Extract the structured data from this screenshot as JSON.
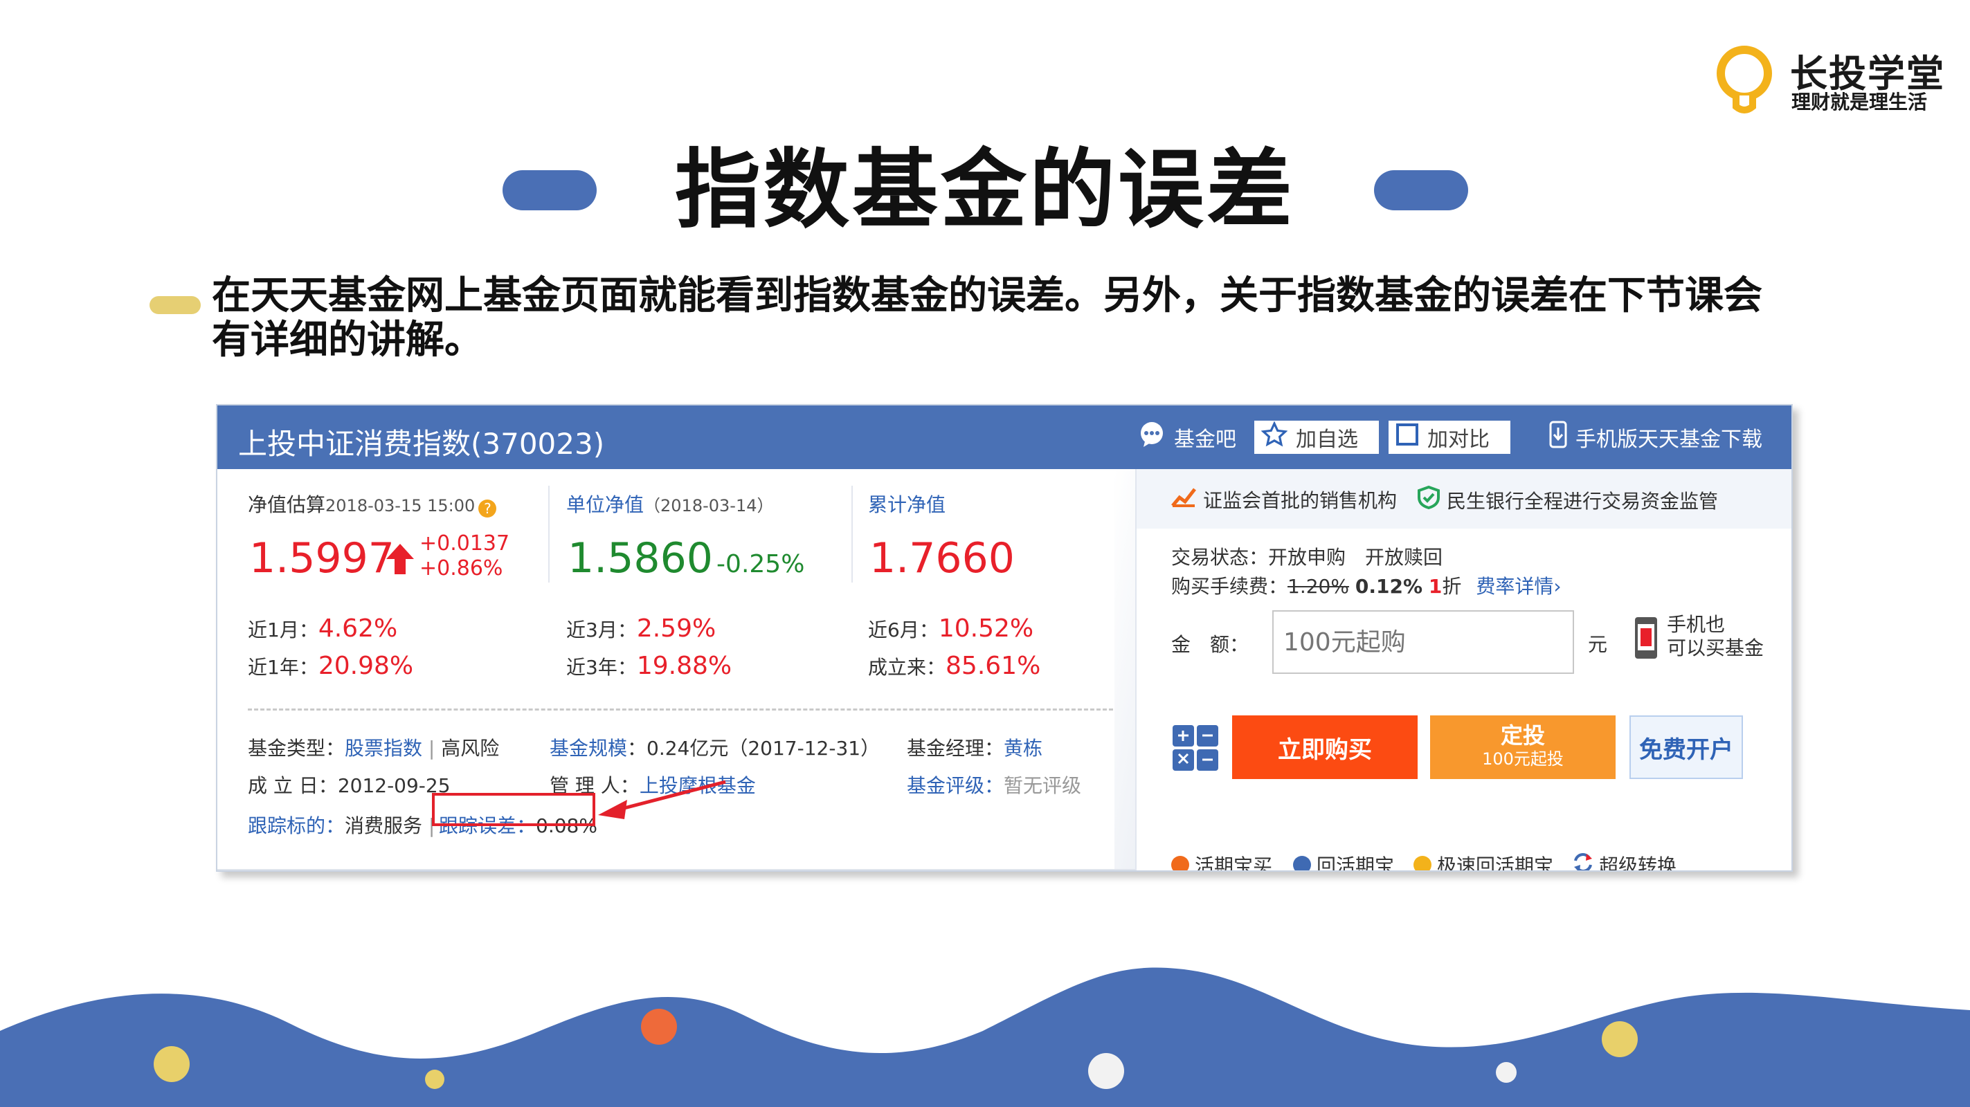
{
  "brand": {
    "name": "长投学堂",
    "slogan": "理财就是理生活"
  },
  "slide": {
    "title": "指数基金的误差",
    "intro": "在天天基金网上基金页面就能看到指数基金的误差。另外，关于指数基金的误差在下节课会有详细的讲解。"
  },
  "fund": {
    "title": "上投中证消费指数(370023)",
    "header_buttons": {
      "bar": "基金吧",
      "watch": "加自选",
      "compare": "加对比",
      "mobile": "手机版天天基金下载"
    },
    "estimate": {
      "label": "净值估算",
      "date": "2018-03-15 15:00",
      "value": "1.5997",
      "change": "+0.0137",
      "change_pct": "+0.86%"
    },
    "unit_nav": {
      "label": "单位净值",
      "date": "（2018-03-14）",
      "value": "1.5860",
      "change_pct": "-0.25%"
    },
    "cum_nav": {
      "label": "累计净值",
      "value": "1.7660"
    },
    "returns": [
      {
        "label": "近1月：",
        "value": "4.62%"
      },
      {
        "label": "近3月：",
        "value": "2.59%"
      },
      {
        "label": "近6月：",
        "value": "10.52%"
      },
      {
        "label": "近1年：",
        "value": "20.98%"
      },
      {
        "label": "近3年：",
        "value": "19.88%"
      },
      {
        "label": "成立来：",
        "value": "85.61%"
      }
    ],
    "info": {
      "type_label": "基金类型：",
      "type_value": "股票指数",
      "risk": "高风险",
      "size_label": "基金规模",
      "size_value": "：0.24亿元（2017-12-31）",
      "manager_label": "基金经理：",
      "manager_value": "黄栋",
      "inception_label": "成 立 日：",
      "inception_value": "2012-09-25",
      "admin_label": "管 理 人：",
      "admin_value": "上投摩根基金",
      "rating_label": "基金评级：",
      "rating_value": "暂无评级",
      "track_label": "跟踪标的：",
      "track_value": "消费服务",
      "tracking_error_label": "跟踪误差：",
      "tracking_error_value": "0.08%"
    }
  },
  "trade": {
    "badge1": "证监会首批的销售机构",
    "badge2": "民生银行全程进行交易资金监管",
    "status_label": "交易状态：",
    "status_buy": "开放申购",
    "status_redeem": "开放赎回",
    "fee_label": "购买手续费：",
    "fee_old": "1.20%",
    "fee_new": "0.12%",
    "fee_discount": "1",
    "fee_discount_unit": "折",
    "fee_detail": "费率详情",
    "amount_label": "金　额：",
    "amount_placeholder": "100元起购",
    "unit": "元",
    "mobile_hint_1": "手机也",
    "mobile_hint_2": "可以买基金",
    "buy": "立即购买",
    "auto": "定投",
    "auto_sub": "100元起投",
    "open": "免费开户",
    "features": [
      "活期宝买",
      "回活期宝",
      "极速回活期宝",
      "超级转换"
    ]
  },
  "colors": {
    "accent_blue": "#4a71b5",
    "rise_red": "#e8202a",
    "fall_green": "#1f8a2f",
    "buy_orange": "#fc4b12",
    "auto_orange": "#f8982d"
  }
}
